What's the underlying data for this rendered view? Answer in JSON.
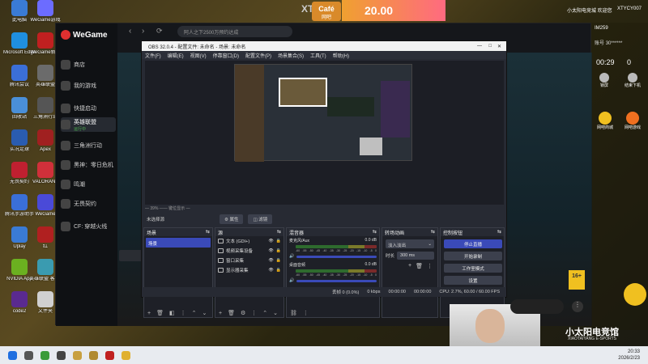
{
  "desktop": {
    "icons": [
      {
        "label": "此电脑",
        "color": "#3a7bd5"
      },
      {
        "label": "WeGame游戏",
        "color": "#6c6cff"
      },
      {
        "label": "Microsoft Edge",
        "color": "#1f8fe0"
      },
      {
        "label": "WeGame新版",
        "color": "#c02020"
      },
      {
        "label": "腾讯会议",
        "color": "#3b6fd8"
      },
      {
        "label": "英雄联盟",
        "color": "#6b6b6b"
      },
      {
        "label": "回收站",
        "color": "#4a8fd8"
      },
      {
        "label": "三角洲行动",
        "color": "#555"
      },
      {
        "label": "实况足球",
        "color": "#2a5cb0"
      },
      {
        "label": "Apex",
        "color": "#a02020"
      },
      {
        "label": "无畏契约",
        "color": "#c02030"
      },
      {
        "label": "VALORANT",
        "color": "#d0303a"
      },
      {
        "label": "腾讯手游助手",
        "color": "#3a6fd8"
      },
      {
        "label": "WeGame",
        "color": "#4a4ad8"
      },
      {
        "label": "Uplay",
        "color": "#3a7bd5"
      },
      {
        "label": "红",
        "color": "#b02020"
      },
      {
        "label": "NVIDIA App",
        "color": "#6bb020"
      },
      {
        "label": "英雄联盟 客户端",
        "color": "#3a9bb0"
      },
      {
        "label": "code2",
        "color": "#5a2a90"
      },
      {
        "label": "文件夹",
        "color": "#d0d0d0"
      }
    ]
  },
  "topbar": {
    "xtrm": "XT",
    "cafe": "Café",
    "cafe_sub": "网吧",
    "banner_num": "20.00",
    "right_text": "小太阳电竞城 欢迎您",
    "user": "XTYCY007"
  },
  "wegame": {
    "logo": "WeGame",
    "search_placeholder": "阿人之下2500万预约达成",
    "nav": [
      {
        "label": "商店"
      },
      {
        "label": "我的游戏"
      },
      {
        "label": "快捷启动"
      },
      {
        "label": "英雄联盟",
        "sub": "运行中",
        "active": true
      },
      {
        "label": "三角洲行动"
      },
      {
        "label": "黑神：零日危机"
      },
      {
        "label": "鸣潮"
      },
      {
        "label": "无畏契约"
      },
      {
        "label": "CF: 穿越火线"
      }
    ]
  },
  "obs": {
    "title": "OBS 32.0.4 - 配置文件: 未命名 - 场景: 未命名",
    "menu": [
      "文件(F)",
      "编辑(E)",
      "视图(V)",
      "停靠窗口(D)",
      "配置文件(P)",
      "场景集合(S)",
      "工具(T)",
      "帮助(H)"
    ],
    "zoom_label": "— 39% ——  键位显示 —",
    "no_source": "未选择源",
    "props_btn": "属性",
    "filters_btn": "滤镜",
    "scenes": {
      "header": "场景",
      "items": [
        "场景"
      ]
    },
    "sources": {
      "header": "源",
      "items": [
        "文本 (GDI+)",
        "视频采集设备",
        "窗口采集",
        "显示器采集"
      ]
    },
    "mixer": {
      "header": "混音器",
      "channels": [
        {
          "name": "麦克风/Aux",
          "db": "0.0 dB"
        },
        {
          "name": "桌面音频",
          "db": "0.0 dB"
        }
      ],
      "scale": [
        "-60",
        "-55",
        "-50",
        "-45",
        "-40",
        "-35",
        "-30",
        "-25",
        "-20",
        "-15",
        "-10",
        "-5",
        "0"
      ]
    },
    "transitions": {
      "header": "转场动画",
      "type": "淡入淡出",
      "duration_label": "时长",
      "duration": "300 ms"
    },
    "controls": {
      "header": "控制按钮",
      "buttons": [
        "停止直播",
        "开始录制",
        "工作室模式",
        "设置"
      ]
    },
    "status": {
      "frames": "丢帧 0 (0.0%)",
      "kbps": "0 kbps",
      "live_time": "00:00:00",
      "rec_time": "00:00:00",
      "cpu": "CPU: 2.7%, 60.00 / 60.00 FPS"
    }
  },
  "right_panel": {
    "id": "IM259",
    "balance_label": "账号",
    "balance": "30******",
    "time": "00:29",
    "time_value": "0",
    "lock_label": "锁屏",
    "logout_label": "结束下机",
    "shop_label": "网吧商城",
    "web_label": "网吧游戏",
    "age_badge": "16+",
    "brand": "小太阳电竞馆",
    "brand_sub": "XIAOTAIYANG E-SPORTS"
  },
  "chat": {
    "placeholder": ""
  },
  "taskbar": {
    "time": "20:33",
    "date": "2026/2/23",
    "icons": [
      "win",
      "search",
      "chrome",
      "obs",
      "game",
      "lol",
      "wegame",
      "folder"
    ]
  },
  "colors": {
    "obs_bg": "#272a33",
    "obs_highlight": "#3a4ab8",
    "wegame_bg": "#15171b",
    "accent_gold": "#c8a040"
  }
}
